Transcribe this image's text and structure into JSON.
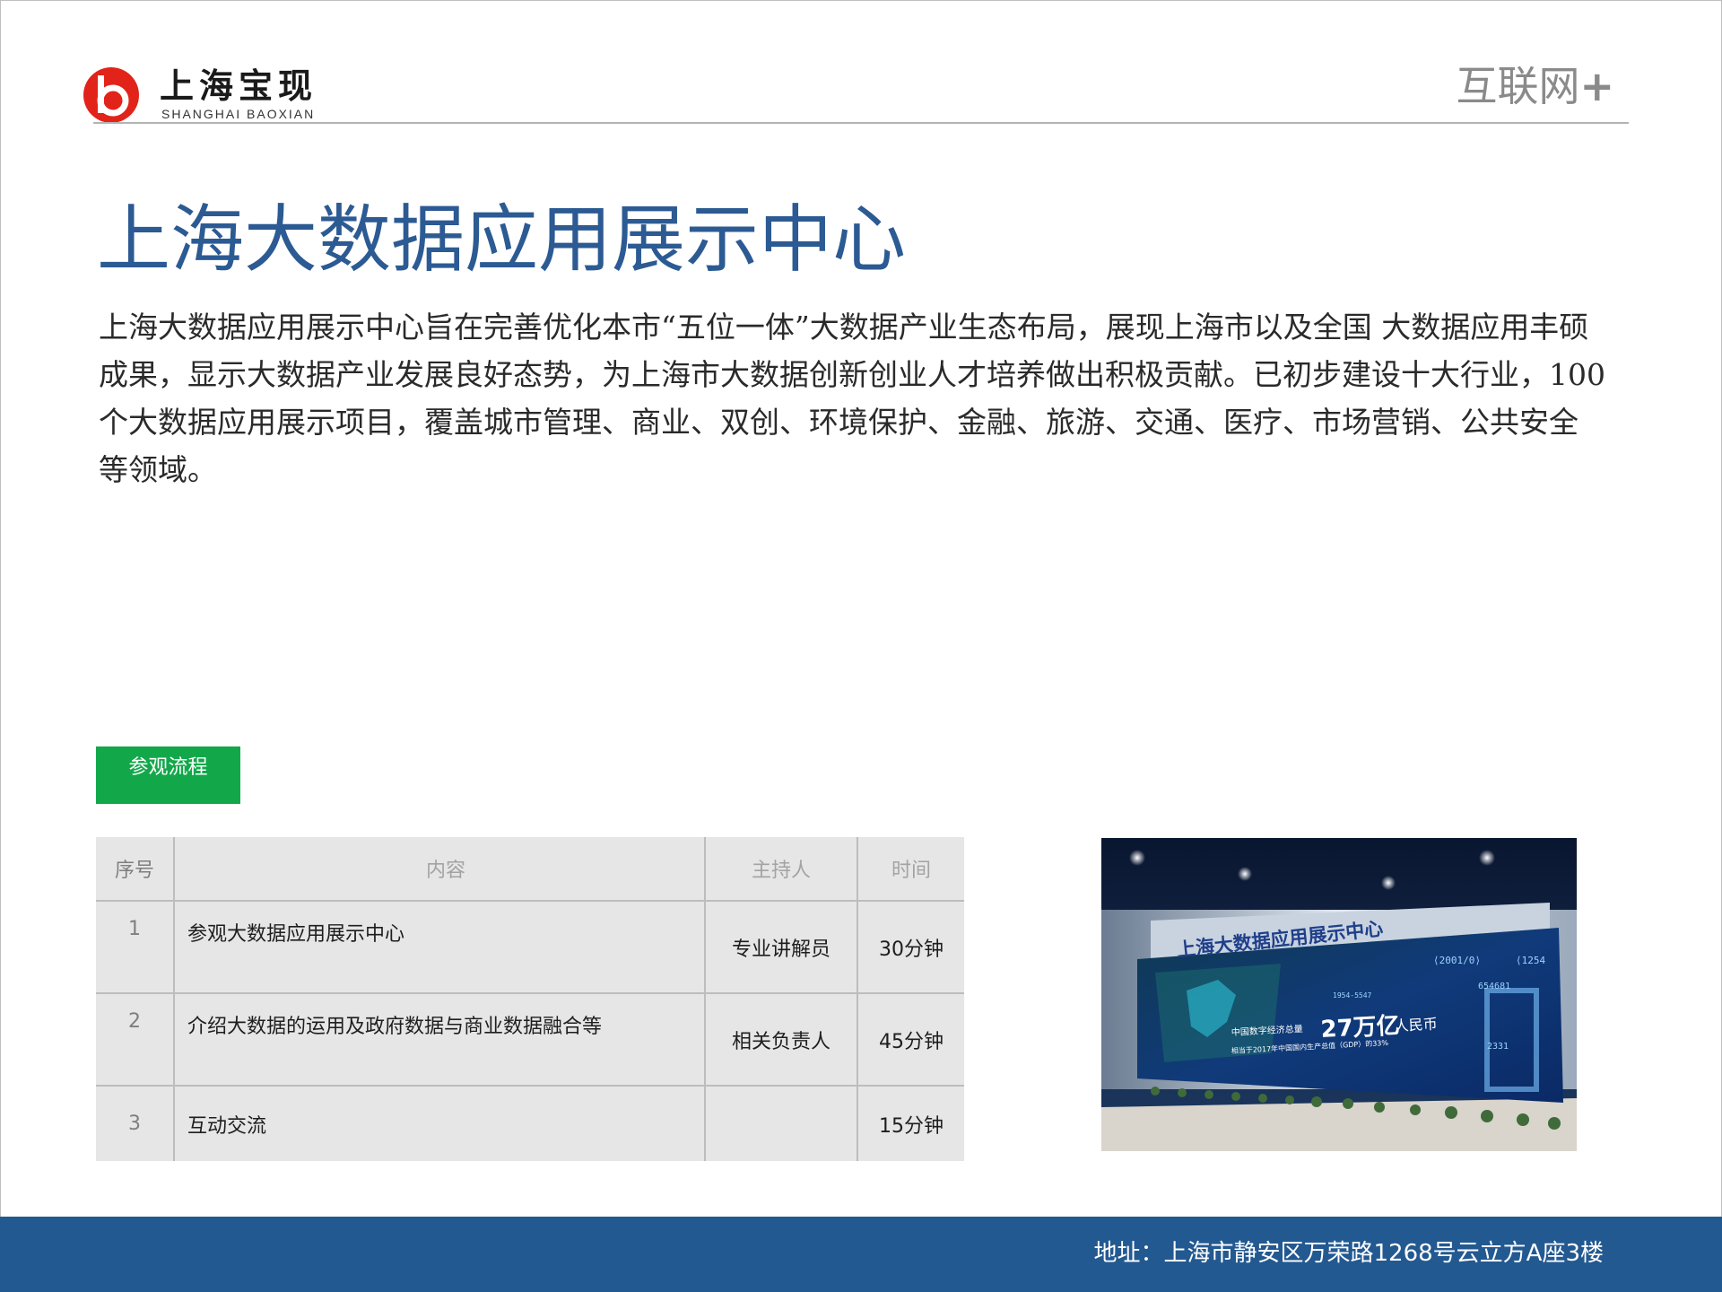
{
  "header": {
    "brand_cn": "上海宝现",
    "brand_en": "SHANGHAI BAOXIAN",
    "tag": "互联网",
    "tag_plus": "+"
  },
  "main": {
    "title": "上海大数据应用展示中心",
    "intro": "上海大数据应用展示中心旨在完善优化本市“五位一体”大数据产业生态布局，展现上海市以及全国 大数据应用丰硕成果，显示大数据产业发展良好态势，为上海市大数据创新创业人才培养做出积极贡献。已初步建设十大行业，100 个大数据应用展示项目，覆盖城市管理、商业、双创、环境保护、金融、旅游、交通、医疗、市场营销、公共安全等领域。"
  },
  "flow": {
    "label": "参观流程",
    "headers": [
      "序号",
      "内容",
      "主持人",
      "时间"
    ],
    "rows": [
      {
        "index": "1",
        "content": "参观大数据应用展示中心",
        "host": "专业讲解员",
        "time": "30分钟"
      },
      {
        "index": "2",
        "content": "介绍大数据的运用及政府数据与商业数据融合等",
        "host": "相关负责人",
        "time": "45分钟"
      },
      {
        "index": "3",
        "content": "互动交流",
        "host": "",
        "time": "15分钟"
      }
    ]
  },
  "photo": {
    "sign": "上海大数据应用展示中心",
    "screen_line1": "中国数字经济总量",
    "screen_big": "27万亿",
    "screen_unit": "人民币",
    "screen_line2": "相当于2017年中国国内生产总值（GDP）的33%",
    "code1": "⟨2001/0⟩",
    "code2": "⟨1254",
    "code3": "654681",
    "code4": "1954-5547",
    "code5": "2331",
    "colors": {
      "bg": "#0b1a33",
      "glow": "#2f7fd6",
      "sign": "#1f3f8a"
    }
  },
  "footer": {
    "address": "地址：上海市静安区万荣路1268号云立方A座3楼"
  },
  "colors": {
    "title": "#2c5a93",
    "green": "#12a84a",
    "footer": "#235991",
    "logo_red": "#e2231a"
  }
}
